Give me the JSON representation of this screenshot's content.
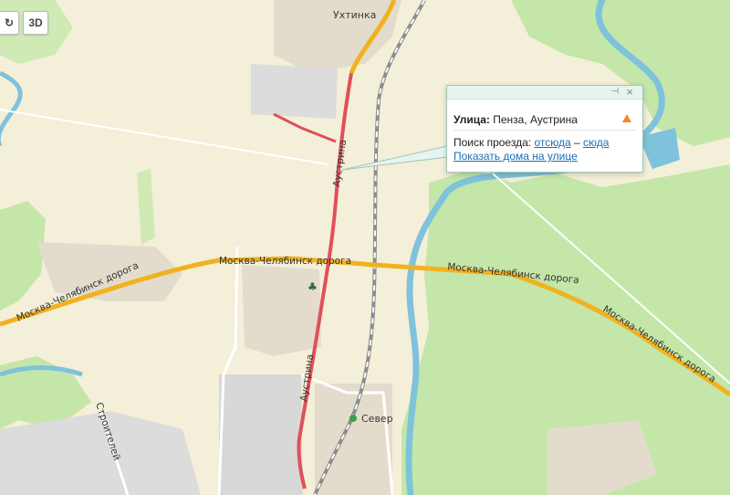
{
  "controls": {
    "rotate_icon": "rotate-icon",
    "three_d_label": "3D"
  },
  "map": {
    "places": {
      "top_village": "Ухтинка",
      "station": "Север"
    },
    "roads": {
      "highway_label": "Москва-Челябинск дорога",
      "street_label": "Аустрина",
      "side_street_label": "Строителей"
    },
    "colors": {
      "land": "#f4efd8",
      "forest": "#c4e6a8",
      "water": "#7fc2dc",
      "highway": "#f1b21f",
      "selected_street": "#e0505a",
      "railway": "#8c8c8c",
      "built": "#e3dccd",
      "industrial": "#dcdcdc"
    }
  },
  "popup": {
    "street_prefix": "Улица:",
    "street_value": "Пенза, Аустрина",
    "route_label": "Поиск проезда:",
    "from_here": "отсюда",
    "dash": "–",
    "to_here": "сюда",
    "show_houses": "Показать дома на улице",
    "icons": {
      "pin": "pin-icon",
      "close": "close-icon",
      "warning": "warning-icon"
    }
  }
}
